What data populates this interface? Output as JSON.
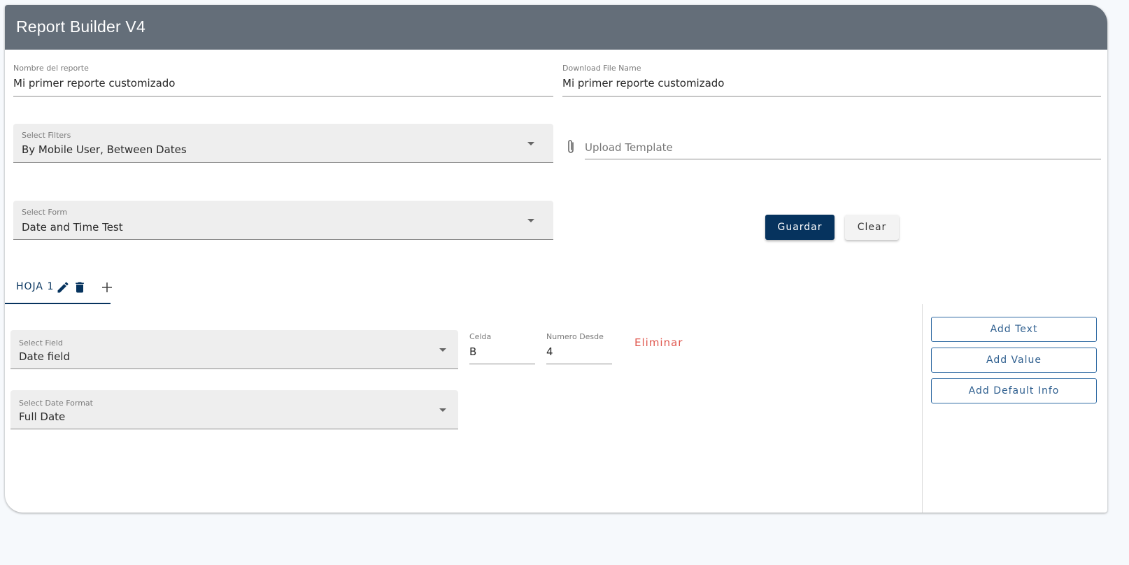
{
  "app": {
    "title": "Report Builder V4"
  },
  "report_name": {
    "label": "Nombre del reporte",
    "value": "Mi primer reporte customizado"
  },
  "download_file_name": {
    "label": "Download File Name",
    "value": "Mi primer reporte customizado"
  },
  "select_filters": {
    "label": "Select Filters",
    "value": "By Mobile User, Between Dates"
  },
  "upload_template": {
    "placeholder": "Upload Template"
  },
  "select_form": {
    "label": "Select Form",
    "value": "Date and Time Test"
  },
  "actions": {
    "save_label": "Guardar",
    "clear_label": "Clear"
  },
  "tabs": [
    {
      "label": "HOJA 1"
    }
  ],
  "sheet": {
    "select_field": {
      "label": "Select Field",
      "value": "Date field"
    },
    "celda": {
      "label": "Celda",
      "value": "B"
    },
    "numero_desde": {
      "label": "Numero Desde",
      "value": "4"
    },
    "delete_label": "Eliminar",
    "select_date_format": {
      "label": "Select Date Format",
      "value": "Full Date"
    }
  },
  "side_actions": {
    "add_text": "Add Text",
    "add_value": "Add Value",
    "add_default_info": "Add Default Info"
  },
  "colors": {
    "header_bg": "#646e79",
    "primary": "#06335e",
    "danger": "#e0584f",
    "outline": "#2f6aa3"
  },
  "icons": [
    "edit-icon",
    "delete-icon",
    "add-icon",
    "attachment-icon",
    "dropdown-arrow-icon"
  ]
}
